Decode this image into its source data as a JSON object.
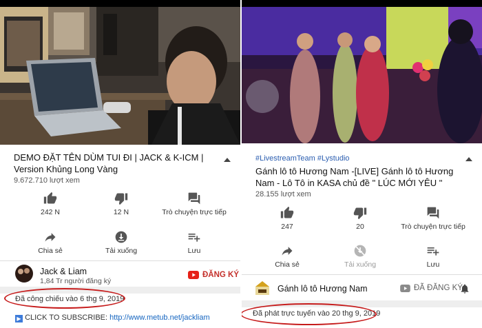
{
  "left": {
    "title": "DEMO ĐẶT TÊN DÙM TUI ĐI | JACK & K-ICM | Version Khủng Long Vàng",
    "views": "9.672.710 lượt xem",
    "actions_row1": [
      {
        "icon": "thumbs-up-icon",
        "label": "242 N"
      },
      {
        "icon": "thumbs-down-icon",
        "label": "12 N"
      },
      {
        "icon": "chat-icon",
        "label": "Trò chuyện trực tiếp"
      }
    ],
    "actions_row2": [
      {
        "icon": "share-icon",
        "label": "Chia sẻ"
      },
      {
        "icon": "download-icon",
        "label": "Tải xuống"
      },
      {
        "icon": "add-playlist-icon",
        "label": "Lưu"
      }
    ],
    "channel": {
      "name": "Jack & Liam",
      "subscribers": "1,84 Tr người đăng ký",
      "subscribe_label": "ĐĂNG KÝ"
    },
    "date": "Đã công chiếu vào 6 thg 9, 2019",
    "description": {
      "prefix": "CLICK TO SUBSCRIBE:",
      "link": "http://www.metub.net/jackliam"
    }
  },
  "right": {
    "tags": "#LivestreamTeam #Lystudio",
    "title": "Gánh lô tô Hương Nam -[LIVE] Gánh lô tô Hương Nam - Lô Tô in KASA chủ đề \" LÚC MỚI YÊU \"",
    "views": "28.155 lượt xem",
    "actions_row1": [
      {
        "icon": "thumbs-up-icon",
        "label": "247"
      },
      {
        "icon": "thumbs-down-icon",
        "label": "20"
      },
      {
        "icon": "chat-icon",
        "label": "Trò chuyện trực tiếp"
      }
    ],
    "actions_row2": [
      {
        "icon": "share-icon",
        "label": "Chia sẻ"
      },
      {
        "icon": "download-disabled-icon",
        "label": "Tải xuống"
      },
      {
        "icon": "add-playlist-icon",
        "label": "Lưu"
      }
    ],
    "channel": {
      "name": "Gánh lô tô Hương Nam",
      "subscribe_label": "ĐÃ ĐĂNG KÝ"
    },
    "date": "Đã phát trực tuyến vào 20 thg 9, 2019"
  },
  "colors": {
    "subscribe_red": "#cc0000",
    "annotation_ring": "#c61b1b",
    "hashtag_blue": "#2a5db0"
  }
}
